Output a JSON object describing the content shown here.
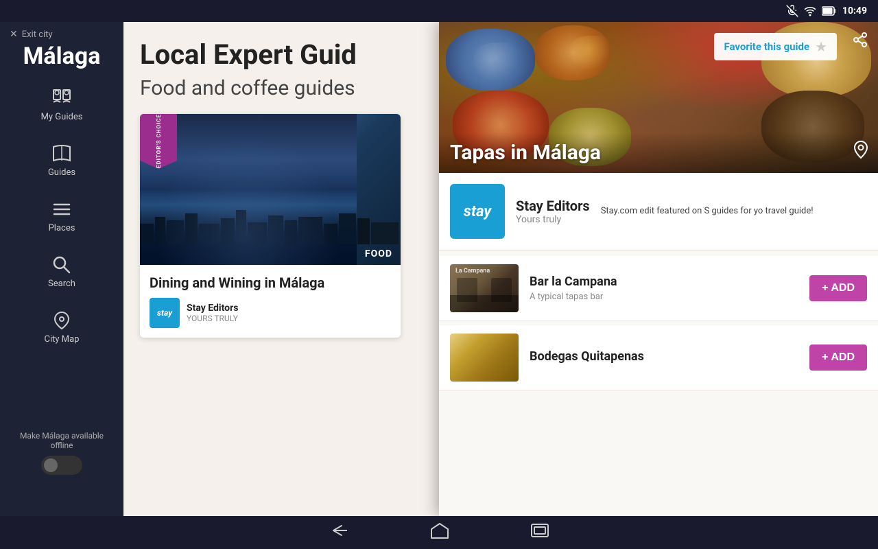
{
  "statusBar": {
    "time": "10:49"
  },
  "sidebar": {
    "exitLabel": "Exit city",
    "cityName": "Málaga",
    "navItems": [
      {
        "id": "my-guides",
        "label": "My Guides"
      },
      {
        "id": "guides",
        "label": "Guides"
      },
      {
        "id": "places",
        "label": "Places"
      },
      {
        "id": "search",
        "label": "Search"
      },
      {
        "id": "city-map",
        "label": "City Map"
      }
    ],
    "offlineText": "Make Málaga available offline"
  },
  "mainPage": {
    "title": "Local Expert Guid",
    "subtitle": "Food and coffee guides",
    "bgCard": {
      "editorsBadge": "EDITOR'S CHOICE",
      "foodLabel": "FOOD",
      "title": "Dining and Wining in Málaga",
      "authorLogo": "stay",
      "authorName": "Stay Editors",
      "authorSub": "YOURS TRULY"
    }
  },
  "overlayPanel": {
    "heroTitle": "Tapas in Málaga",
    "favoriteLabel": "Favorite this guide",
    "authorLogo": "stay",
    "authorName": "Stay Editors",
    "authorSub": "Yours truly",
    "authorDescription": "Stay.com edit featured on S guides for yo travel guide!",
    "places": [
      {
        "name": "Bar la Campana",
        "description": "A typical tapas bar",
        "addLabel": "+ ADD"
      },
      {
        "name": "Bodegas Quitapenas",
        "description": "",
        "addLabel": "+ ADD"
      }
    ]
  },
  "bottomNav": {
    "backIcon": "←",
    "homeIcon": "⌂",
    "recentsIcon": "▭"
  }
}
